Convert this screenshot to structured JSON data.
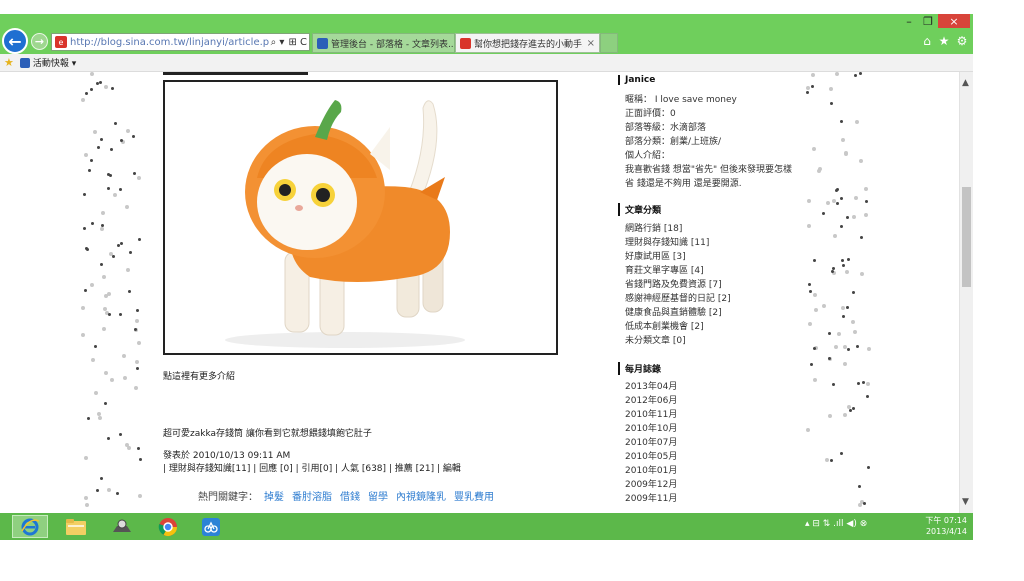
{
  "browser": {
    "address_url": "http://blog.sina.com.tw/linjanyi/article.php?pbg",
    "address_search_glyph": "⌕ ▾",
    "address_compat_glyph": "⊞ C",
    "tabs": [
      {
        "label": "管理後台 - 部落格 - 文章列表...",
        "color": "#2c5fb8"
      },
      {
        "label": "幫你想把錢存進去的小動手...",
        "color": "#d9342b",
        "close": "×"
      }
    ],
    "window": {
      "minimize": "–",
      "maximize": "❐",
      "close": "×"
    },
    "chrome_icons": {
      "home": "⌂",
      "favorites": "★",
      "tools": "⚙"
    },
    "favorites_bar": {
      "item": "活動快報 ▾"
    }
  },
  "article": {
    "more_link": "點這裡有更多介紹",
    "description": "超可愛zakka存錢筒 讓你看到它就想餵錢填飽它肚子",
    "posted_at": "發表於 2010/10/13 09:11 AM",
    "meta": "| 理財與存錢知識[11] | 回應 [0] | 引用[0] | 人氣 [638] | 推薦 [21] | 編輯",
    "hot_keywords_label": "熱門關鍵字：",
    "hot_keywords": [
      "掉髮",
      "番肘溶脂",
      "借錢",
      "留學",
      "內視鏡隆乳",
      "豐乳費用"
    ]
  },
  "sidebar": {
    "profile_name": "Janice",
    "profile_lines": [
      "暱稱： I love save money",
      "正面評價：0",
      "部落等級：水滴部落",
      "部落分類：創業/上班族/",
      "個人介紹：",
      "我喜歡省錢 想當\"省先\" 但後來發現要怎樣",
      "省 錢還是不夠用 還是要開源."
    ],
    "categories_title": "文章分類",
    "categories": [
      "網路行銷 [18]",
      "理財與存錢知識 [11]",
      "好康試用區 [3]",
      "育莊文單字專區 [4]",
      "省錢門路及免費資源 [7]",
      "感謝神經歷基督的日記 [2]",
      "健康食品與直銷體驗 [2]",
      "低成本創業機會 [2]",
      "未分類文章 [0]"
    ],
    "months_title": "每月誌錄",
    "months": [
      "2013年04月",
      "2012年06月",
      "2010年11月",
      "2010年10月",
      "2010年07月",
      "2010年05月",
      "2010年01月",
      "2009年12月",
      "2009年11月"
    ]
  },
  "taskbar": {
    "tray_glyphs": "▴  ⊟  ⇅  .ıll  ◀)  ⊗",
    "clock_time": "下午 07:14",
    "clock_date": "2013/4/14"
  }
}
